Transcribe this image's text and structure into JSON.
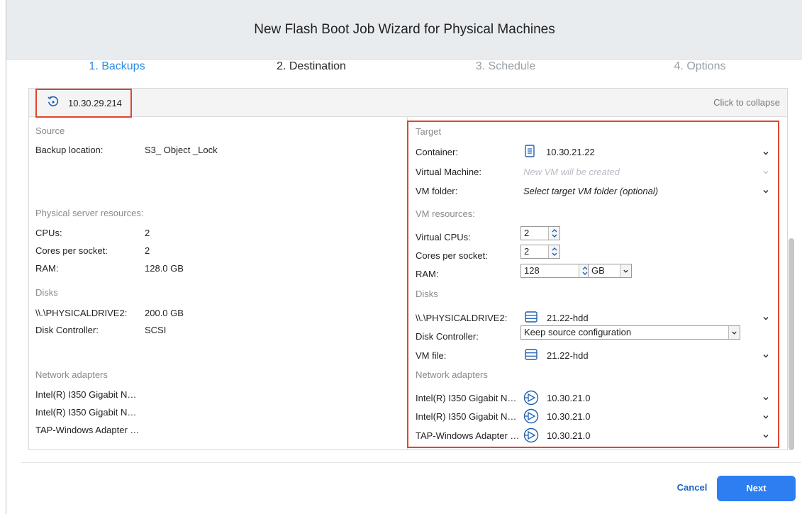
{
  "window": {
    "title": "New Flash Boot Job Wizard for Physical Machines"
  },
  "steps": [
    "1. Backups",
    "2. Destination",
    "3. Schedule",
    "4. Options"
  ],
  "panel": {
    "host": "10.30.29.214",
    "collapse_label": "Click to collapse"
  },
  "source": {
    "title": "Source",
    "backup_location_label": "Backup location:",
    "backup_location_value": "S3_ Object _Lock",
    "resources_title": "Physical server resources:",
    "cpus_label": "CPUs:",
    "cpus_value": "2",
    "cores_label": "Cores per socket:",
    "cores_value": "2",
    "ram_label": "RAM:",
    "ram_value": "128.0 GB",
    "disks_title": "Disks",
    "disk_label": "\\\\.\\PHYSICALDRIVE2:",
    "disk_value": "200.0 GB",
    "controller_label": "Disk Controller:",
    "controller_value": "SCSI",
    "network_title": "Network adapters",
    "adapters": [
      "Intel(R) I350 Gigabit N…",
      "Intel(R) I350 Gigabit N…",
      "TAP-Windows Adapter …"
    ]
  },
  "target": {
    "title": "Target",
    "container_label": "Container:",
    "container_value": "10.30.21.22",
    "vm_label": "Virtual Machine:",
    "vm_placeholder": "New VM will be created",
    "folder_label": "VM folder:",
    "folder_value": "Select target VM folder (optional)",
    "resources_title": "VM resources:",
    "vcpus_label": "Virtual CPUs:",
    "vcpus_value": "2",
    "cores_label": "Cores per socket:",
    "cores_value": "2",
    "ram_label": "RAM:",
    "ram_value": "128",
    "ram_unit": "GB",
    "disks_title": "Disks",
    "disk_label": "\\\\.\\PHYSICALDRIVE2:",
    "disk_value": "21.22-hdd",
    "controller_label": "Disk Controller:",
    "controller_value": "Keep source configuration",
    "vmfile_label": "VM file:",
    "vmfile_value": "21.22-hdd",
    "network_title": "Network adapters",
    "adapters": [
      {
        "label": "Intel(R) I350 Gigabit N…",
        "network": "10.30.21.0"
      },
      {
        "label": "Intel(R) I350 Gigabit N…",
        "network": "10.30.21.0"
      },
      {
        "label": "TAP-Windows Adapter …",
        "network": "10.30.21.0"
      }
    ]
  },
  "footer": {
    "cancel_label": "Cancel",
    "next_label": "Next"
  },
  "colors": {
    "accent": "#2d7ef0",
    "highlight": "#e0452f",
    "link": "#1d63c5"
  }
}
